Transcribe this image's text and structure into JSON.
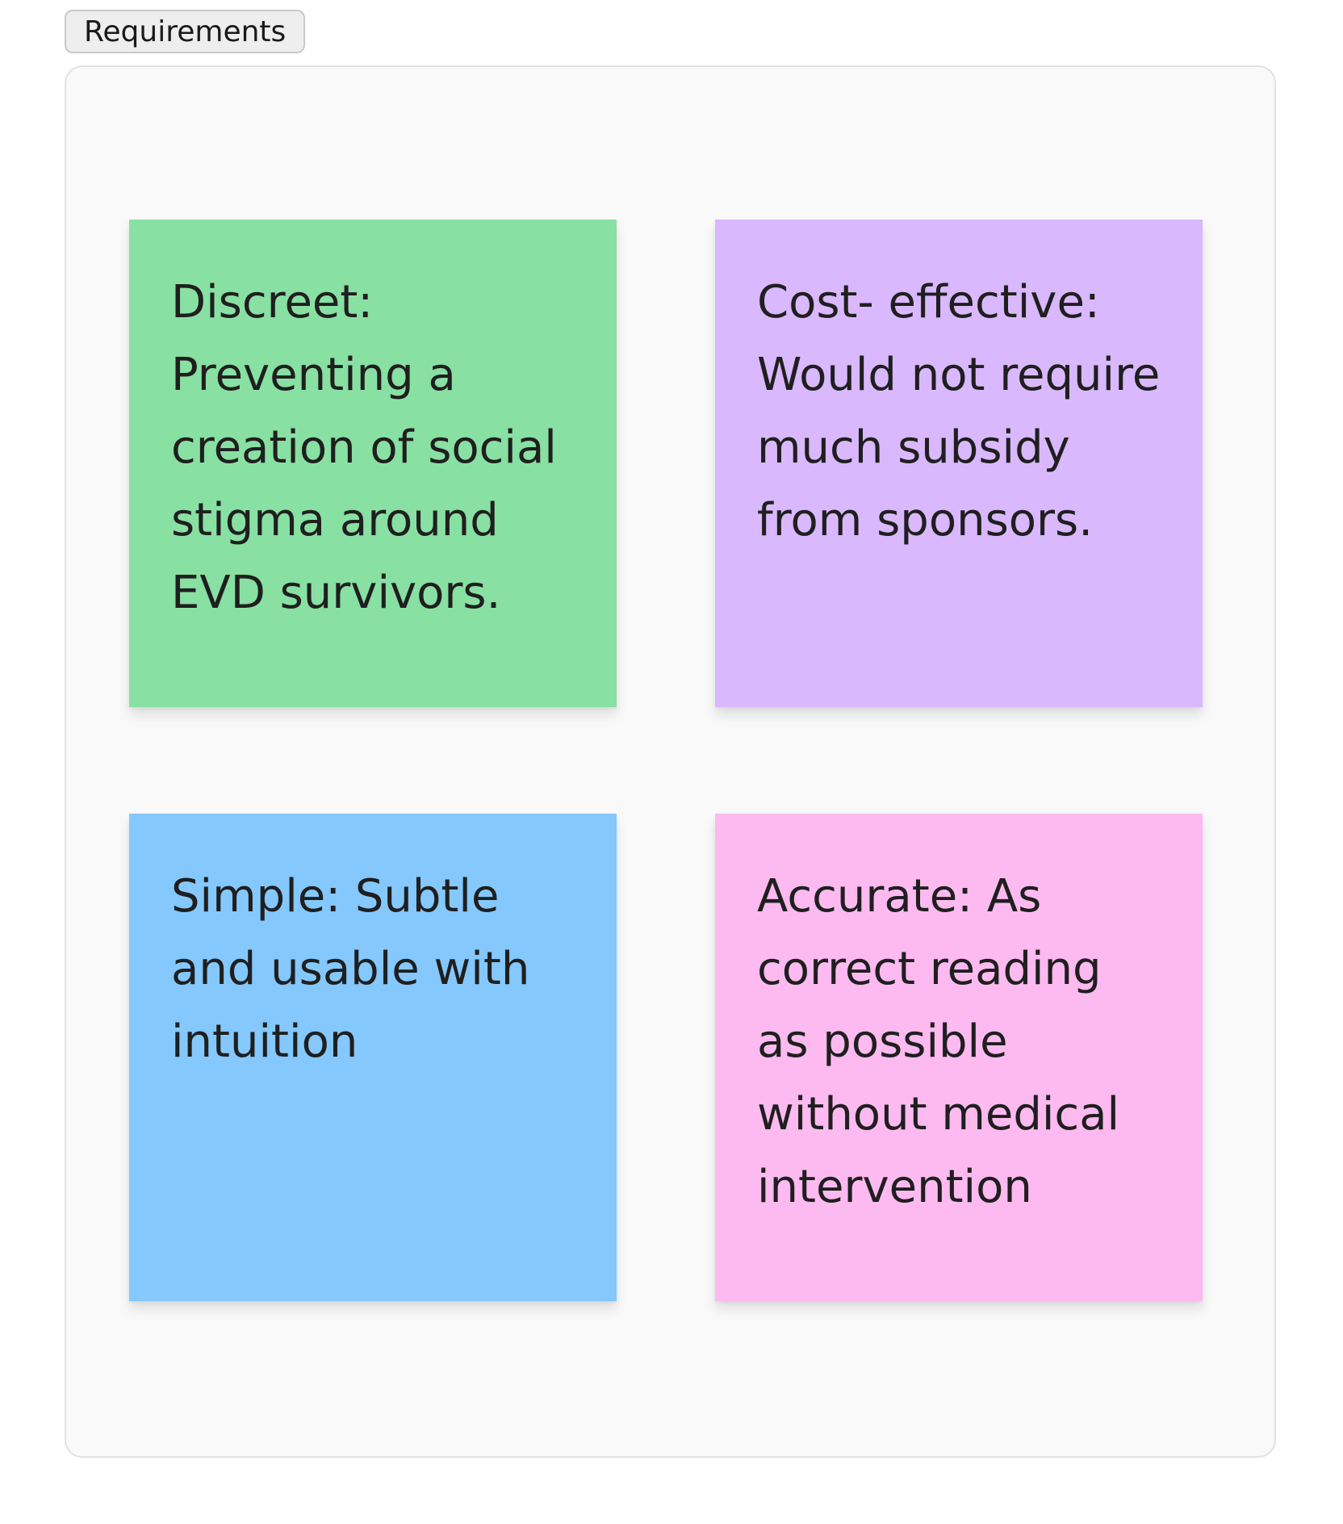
{
  "section": {
    "title": "Requirements"
  },
  "notes": [
    {
      "text": "Discreet: Preventing a creation of social stigma around EVD survivors.",
      "color": "#88e0a3"
    },
    {
      "text": "Cost- effective: Would not require much subsidy from sponsors.",
      "color": "#d9b8fd"
    },
    {
      "text": "Simple: Subtle and usable with intuition",
      "color": "#84c8fd"
    },
    {
      "text": "Accurate: As correct reading as possible without medical intervention",
      "color": "#fcbaf0"
    }
  ]
}
